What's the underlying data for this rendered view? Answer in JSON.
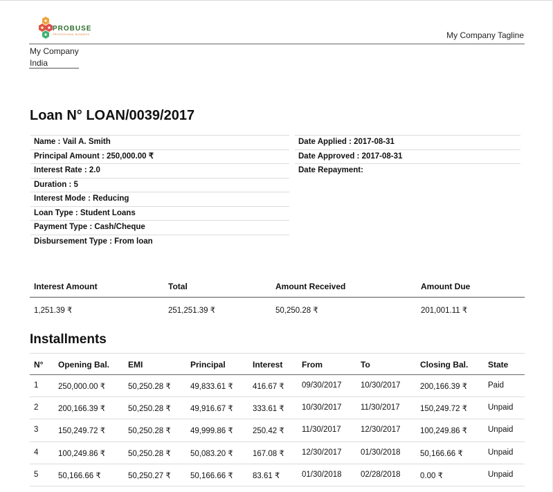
{
  "header": {
    "logo_text": "PROBUSE",
    "logo_subtext": "PROFESSIONAL BUSINESS",
    "tagline": "My Company Tagline",
    "company_name": "My Company",
    "company_country": "India"
  },
  "loan": {
    "title": "Loan N° LOAN/0039/2017",
    "left_fields": [
      "Name : Vail A. Smith",
      "Principal Amount : 250,000.00 ₹",
      "Interest Rate : 2.0",
      "Duration : 5",
      "Interest Mode : Reducing",
      "Loan Type : Student Loans",
      "Payment Type : Cash/Cheque",
      "Disbursement Type : From loan"
    ],
    "right_fields": [
      "Date Applied : 2017-08-31",
      "Date Approved : 2017-08-31",
      "Date Repayment:"
    ]
  },
  "summary": {
    "headers": [
      "Interest Amount",
      "Total",
      "Amount Received",
      "Amount Due"
    ],
    "values": [
      "1,251.39 ₹",
      "251,251.39 ₹",
      "50,250.28 ₹",
      "201,001.11 ₹"
    ]
  },
  "installments": {
    "title": "Installments",
    "headers": [
      "N°",
      "Opening Bal.",
      "EMI",
      "Principal",
      "Interest",
      "From",
      "To",
      "Closing Bal.",
      "State"
    ],
    "rows": [
      [
        "1",
        "250,000.00 ₹",
        "50,250.28 ₹",
        "49,833.61 ₹",
        "416.67 ₹",
        "09/30/2017",
        "10/30/2017",
        "200,166.39 ₹",
        "Paid"
      ],
      [
        "2",
        "200,166.39 ₹",
        "50,250.28 ₹",
        "49,916.67 ₹",
        "333.61 ₹",
        "10/30/2017",
        "11/30/2017",
        "150,249.72 ₹",
        "Unpaid"
      ],
      [
        "3",
        "150,249.72 ₹",
        "50,250.28 ₹",
        "49,999.86 ₹",
        "250.42 ₹",
        "11/30/2017",
        "12/30/2017",
        "100,249.86 ₹",
        "Unpaid"
      ],
      [
        "4",
        "100,249.86 ₹",
        "50,250.28 ₹",
        "50,083.20 ₹",
        "167.08 ₹",
        "12/30/2017",
        "01/30/2018",
        "50,166.66 ₹",
        "Unpaid"
      ],
      [
        "5",
        "50,166.66 ₹",
        "50,250.27 ₹",
        "50,166.66 ₹",
        "83.61 ₹",
        "01/30/2018",
        "02/28/2018",
        "0.00 ₹",
        "Unpaid"
      ]
    ]
  }
}
